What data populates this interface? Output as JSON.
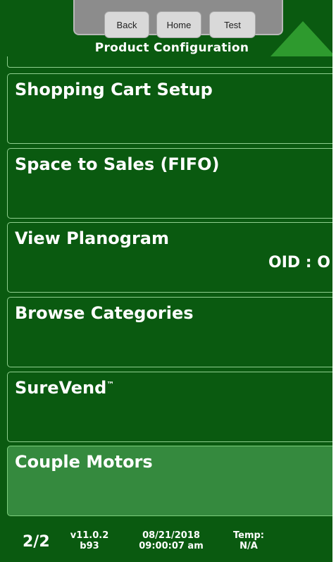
{
  "header": {
    "back_label": "Back",
    "home_label": "Home",
    "test_label": "Test",
    "title": "Product Configuration"
  },
  "menu": {
    "items": [
      {
        "label": "Shopping Cart Setup"
      },
      {
        "label": "Space to Sales (FIFO)"
      },
      {
        "label": "View Planogram",
        "extra": "OID : O"
      },
      {
        "label": "Browse Categories"
      },
      {
        "label": "SureVend",
        "mark": "™"
      },
      {
        "label": "Couple Motors",
        "highlighted": true
      }
    ]
  },
  "footer": {
    "page": "2/2",
    "version": "v11.0.2",
    "build": "b93",
    "date": "08/21/2018",
    "time": "09:00:07 am",
    "temp_label": "Temp:",
    "temp_value": "N/A"
  },
  "colors": {
    "background": "#0a5a10",
    "highlight": "#358a3e",
    "scroll_arrow": "#2e9a2e",
    "header_bar": "#8c8c8c"
  },
  "icons": {
    "scroll_up": "triangle-up-icon"
  }
}
